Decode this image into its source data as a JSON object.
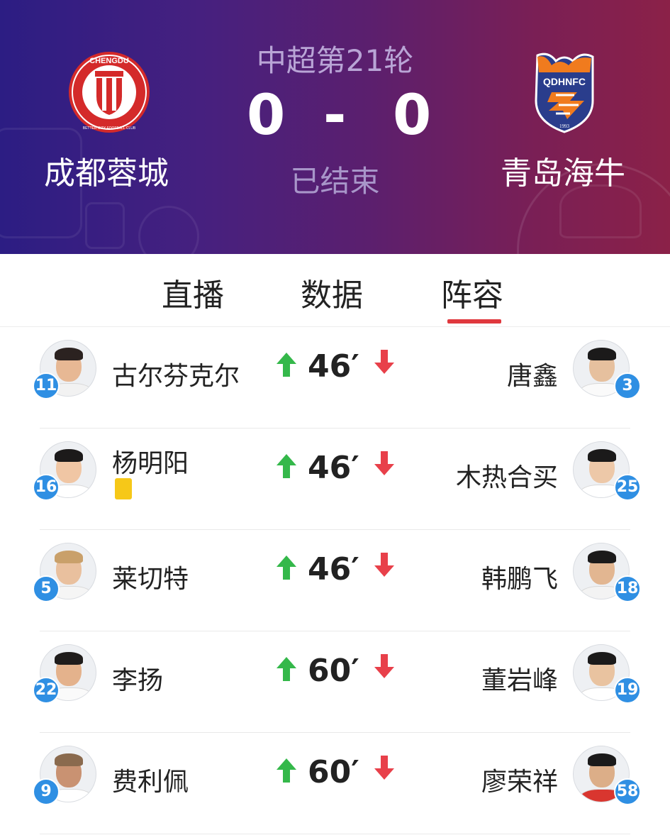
{
  "match": {
    "round": "中超第21轮",
    "home_score": "0",
    "separator": "-",
    "away_score": "0",
    "status": "已结束",
    "home_team": "成都蓉城",
    "away_team": "青岛海牛",
    "home_logo_text": "CHENGDU",
    "home_logo_subtext": "BETTER CITY FOOTBALL CLUB",
    "away_logo_text": "QDHNFC",
    "away_logo_year": "1993"
  },
  "tabs": [
    {
      "label": "直播"
    },
    {
      "label": "数据"
    },
    {
      "label": "阵容",
      "active": true
    }
  ],
  "subs": [
    {
      "home_player": "古尔芬克尔",
      "home_number": "11",
      "minute": "46′",
      "away_player": "唐鑫",
      "away_number": "3",
      "yellow_card": false
    },
    {
      "home_player": "杨明阳",
      "home_number": "16",
      "minute": "46′",
      "away_player": "木热合买",
      "away_number": "25",
      "yellow_card": true
    },
    {
      "home_player": "莱切特",
      "home_number": "5",
      "minute": "46′",
      "away_player": "韩鹏飞",
      "away_number": "18",
      "yellow_card": false
    },
    {
      "home_player": "李扬",
      "home_number": "22",
      "minute": "60′",
      "away_player": "董岩峰",
      "away_number": "19",
      "yellow_card": false
    },
    {
      "home_player": "费利佩",
      "home_number": "9",
      "minute": "60′",
      "away_player": "廖荣祥",
      "away_number": "58",
      "yellow_card": false
    }
  ],
  "colors": {
    "accent_red": "#e0383e",
    "arrow_green": "#34b84a",
    "arrow_red": "#e8404a",
    "number_badge": "#2f8fe3",
    "yellow_card": "#f6c818"
  }
}
